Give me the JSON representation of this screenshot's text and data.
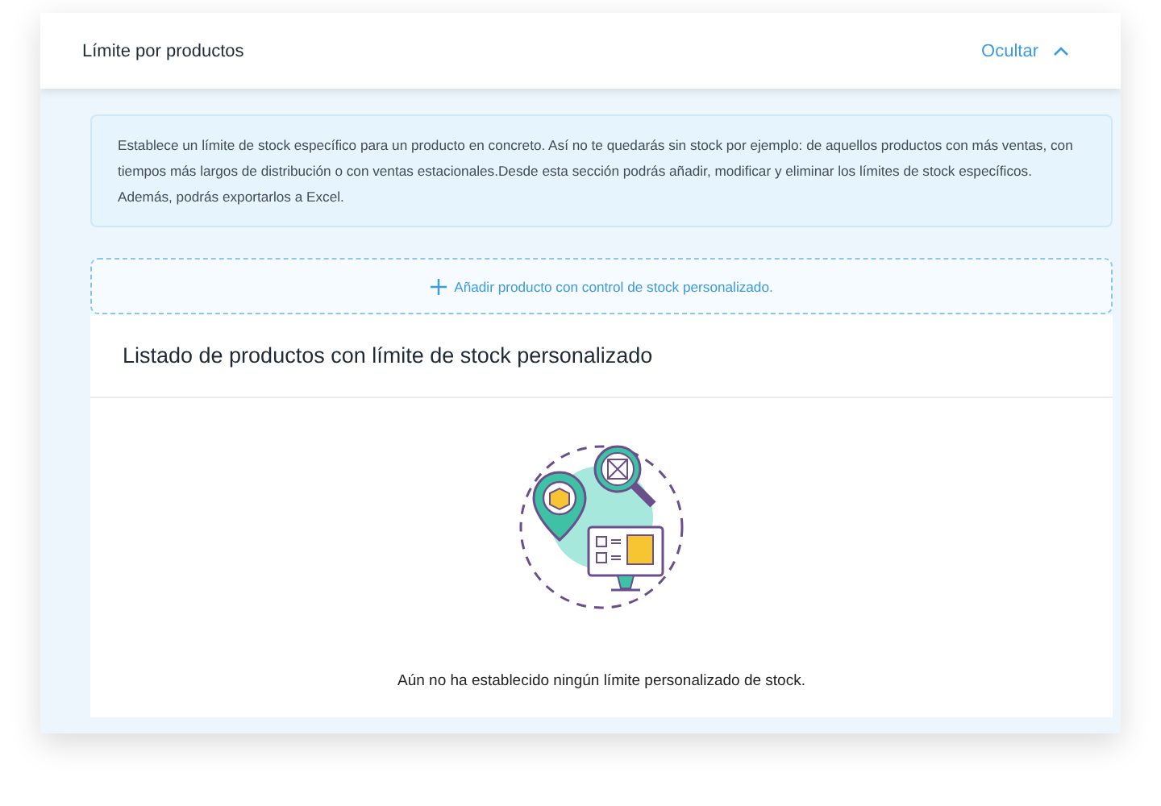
{
  "panel": {
    "title": "Límite por productos",
    "toggle_label": "Ocultar",
    "expanded": true
  },
  "info": "Establece un límite de stock específico para un producto en concreto. Así no te quedarás sin stock por ejemplo: de aquellos productos con más ventas, con tiempos más largos de distribución o con ventas estacionales.Desde esta sección podrás añadir, modificar y eliminar los límites de stock específicos. Además, podrás exportarlos a Excel.",
  "add_button": {
    "label": "Añadir producto con control de stock personalizado."
  },
  "list": {
    "title": "Listado de productos con límite de stock personalizado",
    "empty_message": "Aún no ha establecido ningún límite personalizado de stock."
  }
}
